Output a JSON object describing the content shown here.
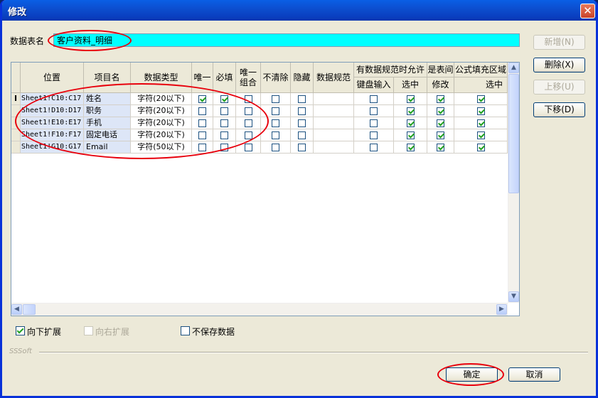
{
  "window": {
    "title": "修改",
    "close_glyph": "✕"
  },
  "table_name": {
    "label": "数据表名",
    "value": "客户资料_明细"
  },
  "buttons": {
    "add": "新增(N)",
    "delete": "删除(X)",
    "move_up": "上移(U)",
    "move_down": "下移(D)",
    "ok": "确定",
    "cancel": "取消"
  },
  "grid": {
    "headers": {
      "position": "位置",
      "item_name": "项目名",
      "data_type": "数据类型",
      "unique": "唯一",
      "required": "必填",
      "unique_combo_1": "唯一",
      "unique_combo_2": "组合",
      "no_clear": "不清除",
      "hidden": "隐藏",
      "data_rule": "数据规范",
      "allow_when_rule": "有数据规范时允许",
      "keyboard_input": "键盘输入",
      "select_a": "选中",
      "is_table": "是表间",
      "modify": "修改",
      "formula_fill": "公式填充区域",
      "select_b": "选中"
    },
    "rows": [
      {
        "marker": "I",
        "position": "Sheet1!C10:C17",
        "name": "姓名",
        "type": "字符(20以下)",
        "unique": true,
        "required": true,
        "combo": false,
        "noclear": false,
        "hidden": false,
        "kbd": false,
        "sel": true,
        "modify": true,
        "fsel": true
      },
      {
        "marker": "",
        "position": "Sheet1!D10:D17",
        "name": "职务",
        "type": "字符(20以下)",
        "unique": false,
        "required": false,
        "combo": false,
        "noclear": false,
        "hidden": false,
        "kbd": false,
        "sel": true,
        "modify": true,
        "fsel": true
      },
      {
        "marker": "",
        "position": "Sheet1!E10:E17",
        "name": "手机",
        "type": "字符(20以下)",
        "unique": false,
        "required": false,
        "combo": false,
        "noclear": false,
        "hidden": false,
        "kbd": false,
        "sel": true,
        "modify": true,
        "fsel": true
      },
      {
        "marker": "",
        "position": "Sheet1!F10:F17",
        "name": "固定电话",
        "type": "字符(20以下)",
        "unique": false,
        "required": false,
        "combo": false,
        "noclear": false,
        "hidden": false,
        "kbd": false,
        "sel": true,
        "modify": true,
        "fsel": true
      },
      {
        "marker": "",
        "position": "Sheet1!G10:G17",
        "name": "Email",
        "type": "字符(50以下)",
        "unique": false,
        "required": false,
        "combo": false,
        "noclear": false,
        "hidden": false,
        "kbd": false,
        "sel": true,
        "modify": true,
        "fsel": true
      }
    ]
  },
  "options": {
    "expand_down": {
      "label": "向下扩展",
      "checked": true
    },
    "expand_right": {
      "label": "向右扩展",
      "checked": false
    },
    "no_save": {
      "label": "不保存数据",
      "checked": false
    }
  },
  "footer": {
    "brand": "SSSoft"
  },
  "colors": {
    "accent_cyan": "#00ffff",
    "annotation_red": "#e8000c",
    "titlebar": "#0a5fe5",
    "check_green": "#21a121"
  }
}
